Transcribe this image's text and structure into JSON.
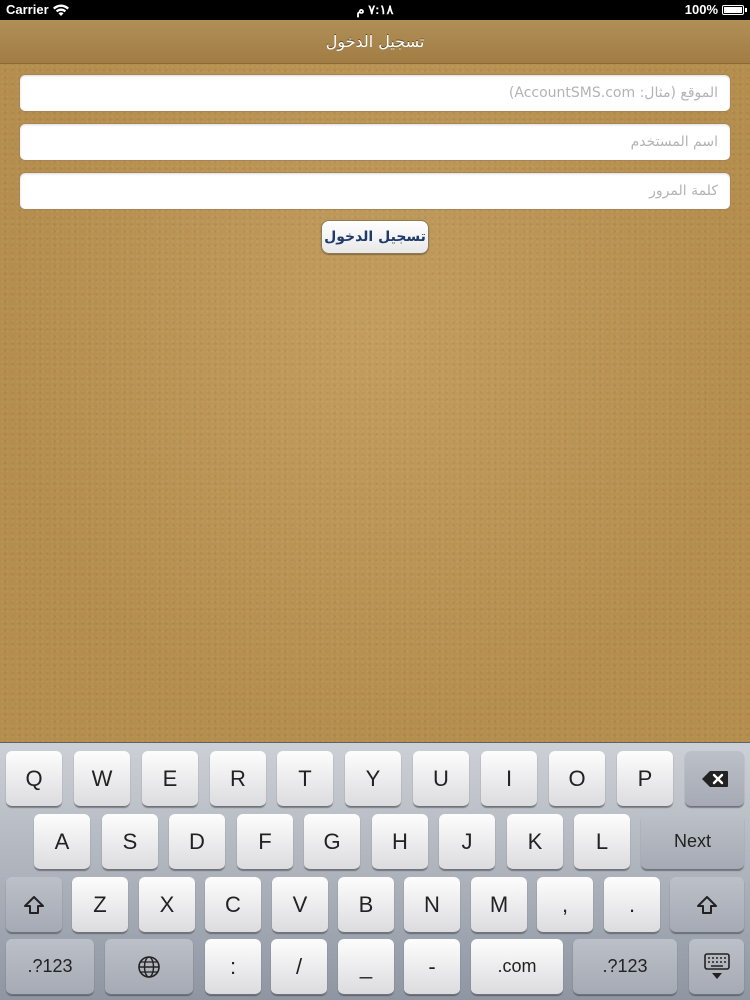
{
  "status_bar": {
    "carrier": "Carrier",
    "time": "٧:١٨ م",
    "battery": "100%"
  },
  "nav": {
    "title": "تسجيل الدخول"
  },
  "form": {
    "site_placeholder": "الموقع (مثال: AccountSMS.com)",
    "username_placeholder": "اسم المستخدم",
    "password_placeholder": "كلمة المرور",
    "login_label": "تسجيل الدخول"
  },
  "keyboard": {
    "row1": [
      "Q",
      "W",
      "E",
      "R",
      "T",
      "Y",
      "U",
      "I",
      "O",
      "P"
    ],
    "row2": [
      "A",
      "S",
      "D",
      "F",
      "G",
      "H",
      "J",
      "K",
      "L"
    ],
    "next_label": "Next",
    "row3": [
      "Z",
      "X",
      "C",
      "V",
      "B",
      "N",
      "M",
      ",",
      "."
    ],
    "row4": {
      "numbers_left": ".?123",
      "colon": ":",
      "slash": "/",
      "underscore": "_",
      "dash": "-",
      "dotcom": ".com",
      "numbers_right": ".?123"
    },
    "icons": {
      "delete": "backspace-icon",
      "shift": "shift-icon",
      "globe": "globe-icon",
      "hide": "keyboard-hide-icon"
    }
  }
}
